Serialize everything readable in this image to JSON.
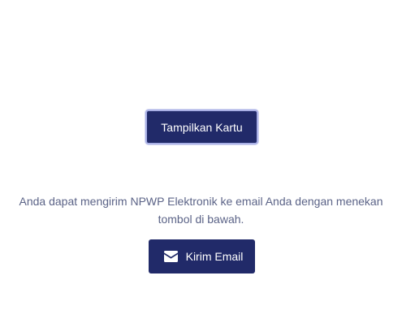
{
  "card": {
    "show_label": "Tampilkan Kartu"
  },
  "email": {
    "info_text": "Anda dapat mengirim NPWP Elektronik ke email Anda dengan menekan tombol di bawah.",
    "send_label": "Kirim Email",
    "icon": "envelope-icon"
  },
  "colors": {
    "button_bg": "#212a69",
    "button_text": "#ffffff",
    "focus_ring": "#a9b0e6",
    "body_text": "#5b6387"
  }
}
